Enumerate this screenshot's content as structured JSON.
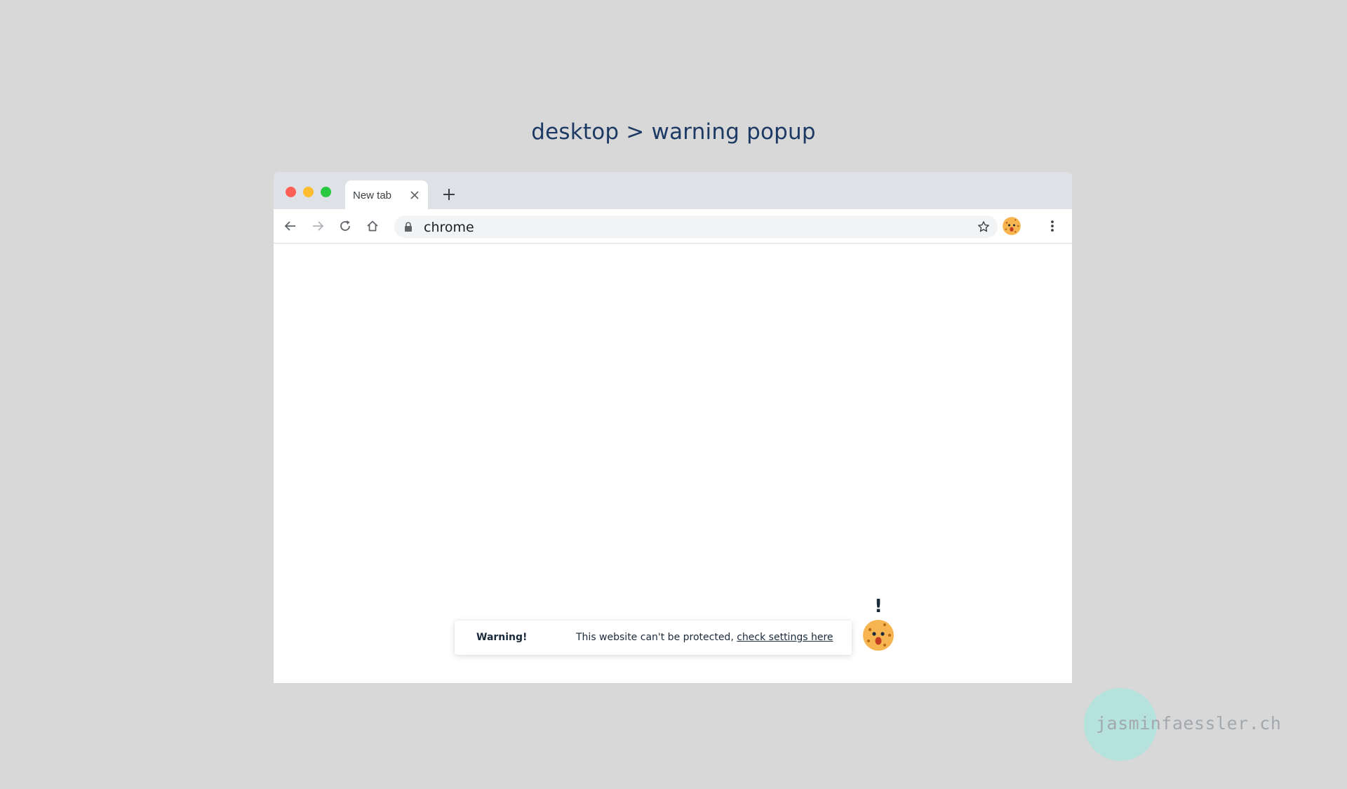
{
  "page": {
    "title": "desktop > warning popup"
  },
  "browser": {
    "tab": {
      "title": "New tab",
      "close_icon": "close-icon"
    },
    "new_tab_icon": "plus-icon",
    "toolbar": {
      "back_icon": "arrow-left-icon",
      "forward_icon": "arrow-right-icon",
      "reload_icon": "reload-icon",
      "home_icon": "home-icon",
      "address": {
        "lock_icon": "lock-icon",
        "url": "chrome",
        "bookmark_icon": "star-icon"
      },
      "extension_icon": "cookie-icon",
      "menu_icon": "more-vertical-icon"
    },
    "traffic_lights": {
      "red": "#fe5f57",
      "yellow": "#febc2e",
      "green": "#28c840"
    }
  },
  "warning_popup": {
    "label": "Warning!",
    "message": "This website can't be protected, ",
    "link": "check settings here",
    "mascot_icon": "cookie-icon",
    "alert_mark": "!"
  },
  "watermark": {
    "text": "jasminfaessler.ch"
  },
  "colors": {
    "background": "#d8d8d9",
    "title": "#1c3a63",
    "tabbar": "#dee1e6",
    "cookie": "#f7b552",
    "watermark_circle": "#b5e2dc"
  }
}
